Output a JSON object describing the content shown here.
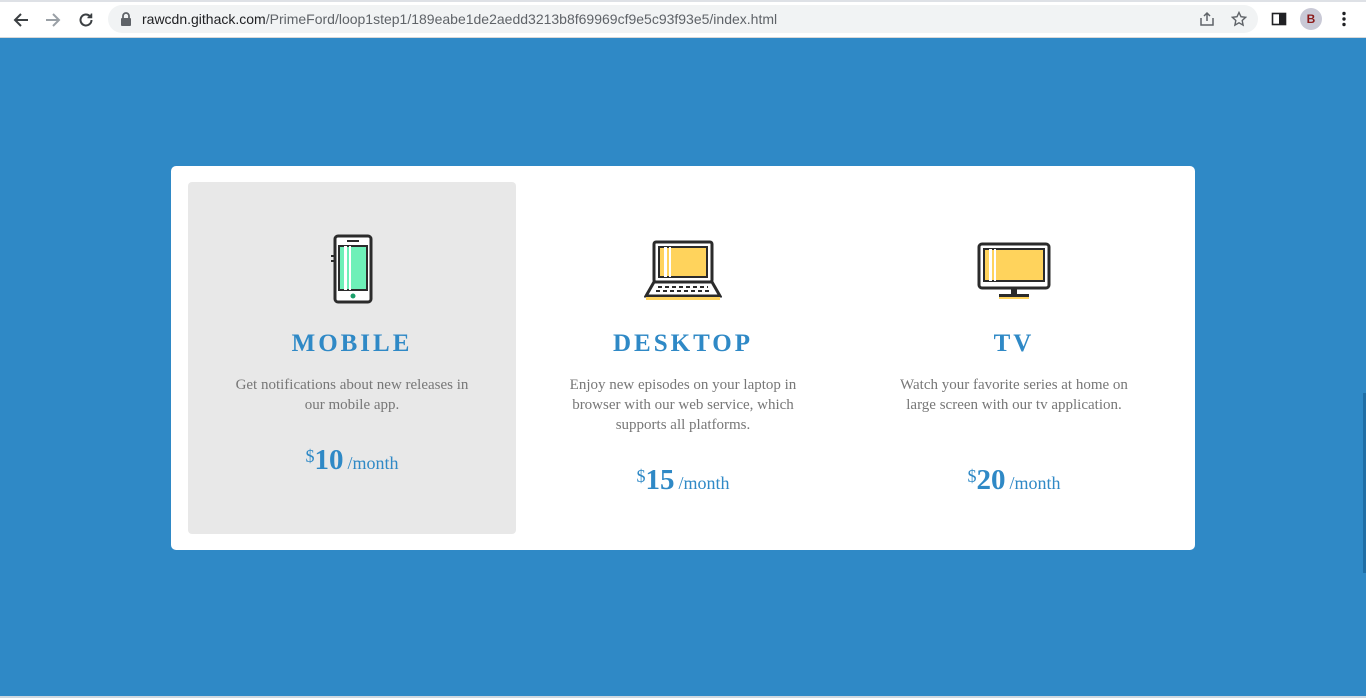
{
  "browser": {
    "url_host": "rawcdn.githack.com",
    "url_path": "/PrimeFord/loop1step1/189eabe1de2aedd3213b8f69969cf9e5c93f93e5/index.html",
    "profile_initial": "B"
  },
  "plans": [
    {
      "title": "MOBILE",
      "description": "Get notifications about new releases in our mobile app.",
      "currency": "$",
      "amount": "10",
      "period": "/month",
      "icon": "smartphone-icon"
    },
    {
      "title": "DESKTOP",
      "description": "Enjoy new episodes on your laptop in browser with our web service, which supports all platforms.",
      "currency": "$",
      "amount": "15",
      "period": "/month",
      "icon": "laptop-icon"
    },
    {
      "title": "TV",
      "description": "Watch your favorite series at home on large screen with our tv application.",
      "currency": "$",
      "amount": "20",
      "period": "/month",
      "icon": "tv-icon"
    }
  ],
  "colors": {
    "page_background": "#2f89c6",
    "accent": "#2f89c6",
    "active_card": "#e8e8e8",
    "icon_green": "#6ef0b8",
    "icon_yellow": "#ffd35c"
  }
}
